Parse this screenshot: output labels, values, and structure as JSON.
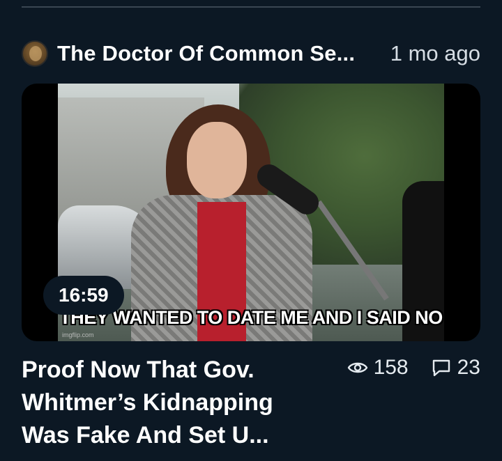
{
  "post": {
    "author_name": "The Doctor Of Common Se...",
    "time_ago": "1 mo ago",
    "video": {
      "duration": "16:59",
      "thumbnail_caption": "THEY WANTED TO DATE ME AND I SAID NO",
      "thumbnail_watermark": "imgflip.com"
    },
    "title": "Proof Now That Gov. Whitmer’s Kidnapping Was Fake And Set U...",
    "views": "158",
    "comments": "23",
    "icons": {
      "avatar": "author-avatar",
      "views": "eye-icon",
      "comments": "comment-icon"
    }
  }
}
